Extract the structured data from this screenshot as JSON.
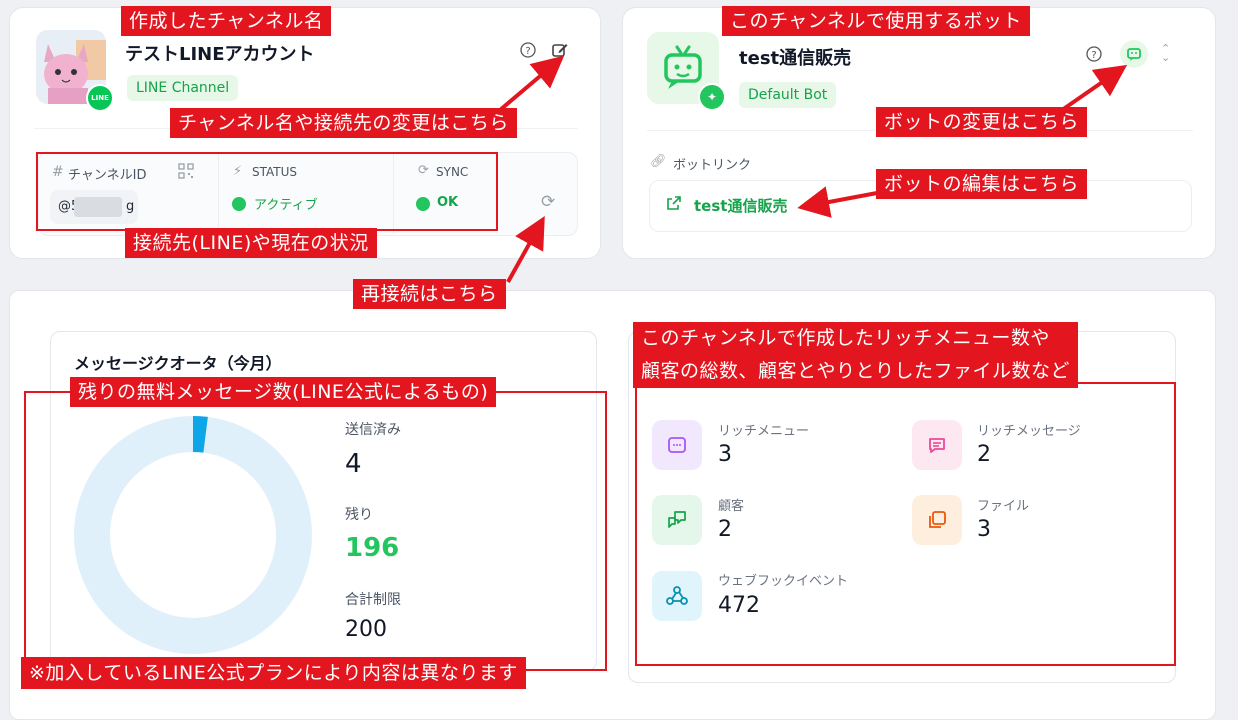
{
  "channel": {
    "name": "テストLINEアカウント",
    "badge": "LINE Channel",
    "id_label": "チャンネルID",
    "id_prefix": "@5",
    "id_suffix": "g",
    "status_label": "STATUS",
    "status_value": "アクティブ",
    "sync_label": "SYNC",
    "sync_value": "OK",
    "avatar_badge": "LINE"
  },
  "bot": {
    "name": "test通信販売",
    "badge": "Default Bot",
    "link_label": "ボットリンク",
    "link_text": "test通信販売"
  },
  "quota": {
    "title": "メッセージクオータ（今月）",
    "sent_label": "送信済み",
    "sent_value": "4",
    "remaining_label": "残り",
    "remaining_value": "196",
    "limit_label": "合計制限",
    "limit_value": "200",
    "used_fraction": 0.02
  },
  "stats": [
    {
      "label": "リッチメニュー",
      "value": "3",
      "icon": "rich-menu-icon",
      "bg": "#f1e8fd",
      "fg": "#a855f7"
    },
    {
      "label": "リッチメッセージ",
      "value": "2",
      "icon": "message-icon",
      "bg": "#fde7f1",
      "fg": "#ec4899"
    },
    {
      "label": "顧客",
      "value": "2",
      "icon": "chat-icon",
      "bg": "#e5f6ea",
      "fg": "#16a34a"
    },
    {
      "label": "ファイル",
      "value": "3",
      "icon": "files-icon",
      "bg": "#fdeedd",
      "fg": "#ea580c"
    },
    {
      "label": "ウェブフックイベント",
      "value": "472",
      "icon": "webhook-icon",
      "bg": "#dff4fb",
      "fg": "#0891b2"
    }
  ],
  "annotations": {
    "channel_name": "作成したチャンネル名",
    "bot_used": "このチャンネルで使用するボット",
    "change_channel": "チャンネル名や接続先の変更はこちら",
    "change_bot": "ボットの変更はこちら",
    "edit_bot": "ボットの編集はこちら",
    "connection": "接続先(LINE)や現在の状況",
    "reconnect": "再接続はこちら",
    "remaining_free": "残りの無料メッセージ数(LINE公式によるもの)",
    "stats_line1": "このチャンネルで作成したリッチメニュー数や",
    "stats_line2": "顧客の総数、顧客とやりとりしたファイル数など",
    "plan_note": "※加入しているLINE公式プランにより内容は異なります"
  },
  "colors": {
    "accent_green": "#22c55e",
    "annotation_red": "#e3161f",
    "ring_bg": "#e0f0fb",
    "ring_used": "#0ea5e9"
  }
}
